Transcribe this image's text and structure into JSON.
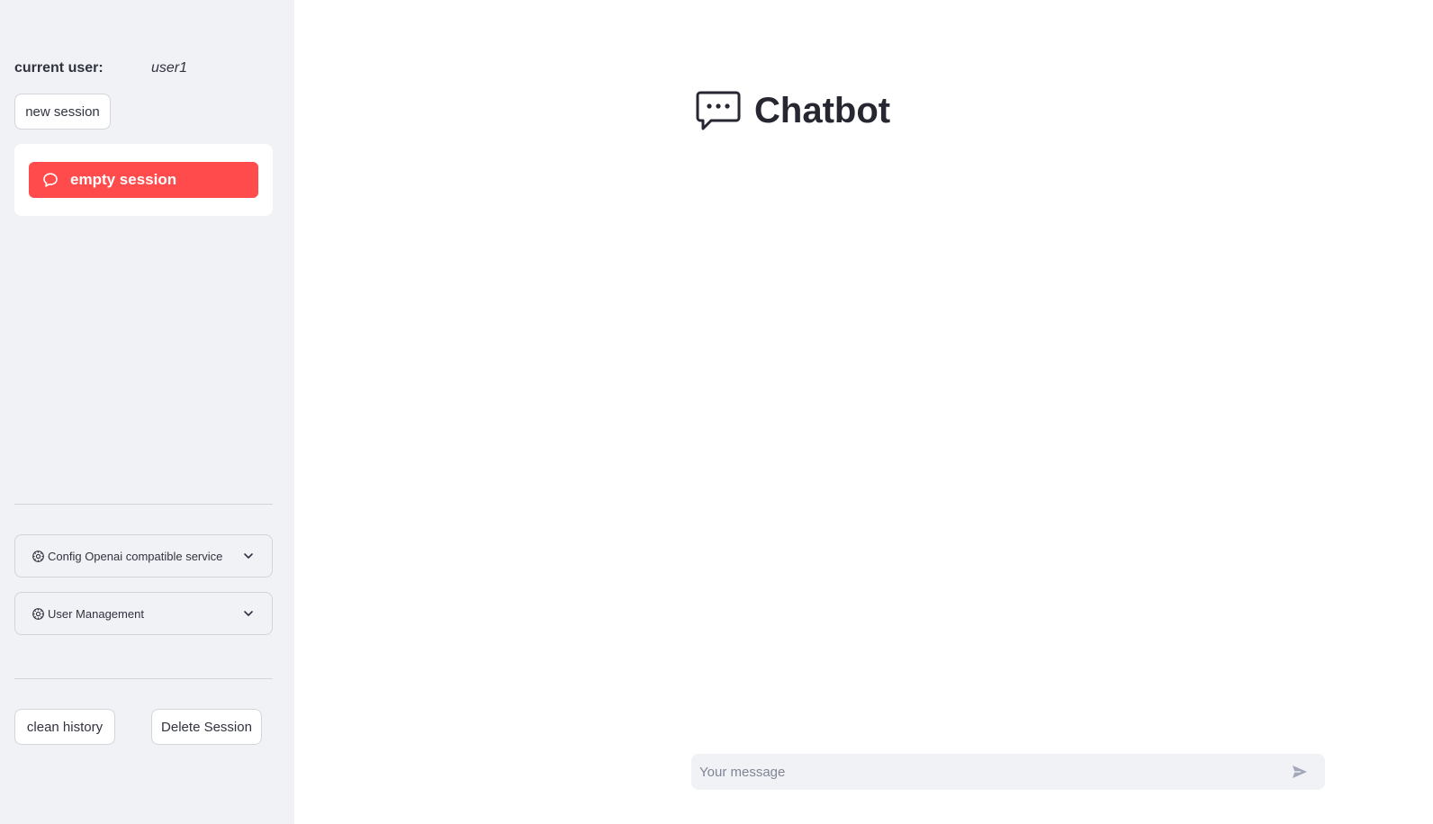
{
  "sidebar": {
    "current_user_label": "current user:",
    "current_user_value": "user1",
    "new_session_label": "new session",
    "sessions": [
      {
        "label": "empty session",
        "active": true,
        "icon": "chat-bubble-icon"
      }
    ],
    "expanders": [
      {
        "label": "Config Openai compatible service",
        "icon": "gear-icon"
      },
      {
        "label": "User Management",
        "icon": "gear-icon"
      }
    ],
    "clean_history_label": "clean history",
    "delete_session_label": "Delete Session"
  },
  "main": {
    "title": "Chatbot",
    "title_icon": "chat-dots-icon",
    "chat_input": {
      "placeholder": "Your message",
      "value": ""
    },
    "send_icon": "send-icon"
  },
  "colors": {
    "sidebar_bg": "#f0f2f6",
    "accent": "#ff4b4b",
    "text": "#31333f"
  }
}
